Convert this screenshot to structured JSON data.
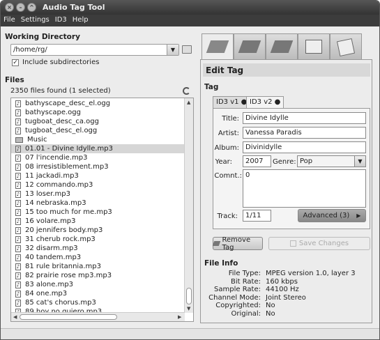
{
  "window": {
    "title": "Audio Tag Tool"
  },
  "menu": [
    "File",
    "Settings",
    "ID3",
    "Help"
  ],
  "workdir": {
    "heading": "Working Directory",
    "path": "/home/rg/",
    "include_subdirs": "Include subdirectories"
  },
  "files": {
    "heading": "Files",
    "count": "2350 files found (1 selected)",
    "items": [
      {
        "name": "bathyscape_desc_el.ogg",
        "type": "file"
      },
      {
        "name": "bathyscape.ogg",
        "type": "file"
      },
      {
        "name": "tugboat_desc_ca.ogg",
        "type": "file"
      },
      {
        "name": "tugboat_desc_el.ogg",
        "type": "file"
      },
      {
        "name": "Music",
        "type": "folder"
      },
      {
        "name": "01.01 - Divine Idylle.mp3",
        "type": "file",
        "selected": true
      },
      {
        "name": "07 l'incendie.mp3",
        "type": "file"
      },
      {
        "name": "08 irresistiblement.mp3",
        "type": "file"
      },
      {
        "name": "11 jackadi.mp3",
        "type": "file"
      },
      {
        "name": "12 commando.mp3",
        "type": "file"
      },
      {
        "name": "13 loser.mp3",
        "type": "file"
      },
      {
        "name": "14 nebraska.mp3",
        "type": "file"
      },
      {
        "name": "15 too much for me.mp3",
        "type": "file"
      },
      {
        "name": "16 volare.mp3",
        "type": "file"
      },
      {
        "name": "20 jennifers body.mp3",
        "type": "file"
      },
      {
        "name": "31 cherub rock.mp3",
        "type": "file"
      },
      {
        "name": "32 disarm.mp3",
        "type": "file"
      },
      {
        "name": "40 tandem.mp3",
        "type": "file"
      },
      {
        "name": "81 rule britannia.mp3",
        "type": "file"
      },
      {
        "name": "82 prairie rose mp3.mp3",
        "type": "file"
      },
      {
        "name": "83 alone.mp3",
        "type": "file"
      },
      {
        "name": "84 one.mp3",
        "type": "file"
      },
      {
        "name": "85 cat's chorus.mp3",
        "type": "file"
      },
      {
        "name": "89 hoy no quiero.mp3",
        "type": "file"
      }
    ]
  },
  "edit": {
    "heading": "Edit Tag",
    "tag_label": "Tag",
    "tab_v1": "ID3 v1",
    "tab_v2": "ID3 v2",
    "labels": {
      "title": "Title:",
      "artist": "Artist:",
      "album": "Album:",
      "year": "Year:",
      "genre": "Genre:",
      "comment": "Comnt.:",
      "track": "Track:"
    },
    "values": {
      "title": "Divine Idylle",
      "artist": "Vanessa Paradis",
      "album": "Divinidylle",
      "year": "2007",
      "genre": "Pop",
      "comment": "0",
      "track": "1/11"
    },
    "advanced": "Advanced (3)",
    "remove": "Remove Tag",
    "save": "Save Changes"
  },
  "fileinfo": {
    "heading": "File Info",
    "rows": [
      {
        "k": "File Type:",
        "v": "MPEG version 1.0, layer 3"
      },
      {
        "k": "Bit Rate:",
        "v": "160 kbps"
      },
      {
        "k": "Sample Rate:",
        "v": "44100 Hz"
      },
      {
        "k": "Channel Mode:",
        "v": "Joint Stereo"
      },
      {
        "k": "Copyrighted:",
        "v": "No"
      },
      {
        "k": "Original:",
        "v": "No"
      }
    ]
  },
  "icons": [
    "edit-tag-icon",
    "edit-multiple-icon",
    "remove-tags-icon",
    "rename-files-icon",
    "paste-file-icon"
  ]
}
